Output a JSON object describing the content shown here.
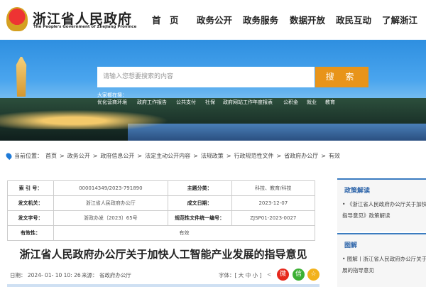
{
  "header": {
    "title": "浙江省人民政府",
    "subtitle": "The People's Government of Zhejiang Province",
    "nav": [
      "首　页",
      "政务公开",
      "政务服务",
      "数据开放",
      "政民互动",
      "了解浙江"
    ]
  },
  "search": {
    "placeholder": "请输入您想要搜索的内容",
    "button": "搜 索",
    "hot_label": "大家都在搜：",
    "hot": [
      "优化营商环境",
      "政府工作报告",
      "公共支付",
      "社保",
      "政府网站工作年度报表",
      "公积金",
      "就业",
      "教育"
    ]
  },
  "breadcrumb": {
    "label": "当前位置：",
    "items": [
      "首页",
      "政务公开",
      "政府信息公开",
      "法定主动公开内容",
      "法规政策",
      "行政规范性文件",
      "省政府办公厅",
      "有效"
    ]
  },
  "info": {
    "index_label": "索 引 号：",
    "index": "000014349/2023-791890",
    "topic_label": "主题分类：",
    "topic": "科技、教育/科技",
    "org_label": "发文机关：",
    "org": "浙江省人民政府办公厅",
    "date_label": "成文日期：",
    "date": "2023-12-07",
    "docno_label": "发文字号：",
    "docno": "浙政办发〔2023〕65号",
    "code_label": "规范性文件统一编号：",
    "code": "ZJSP01-2023-0027",
    "valid_label": "有效性：",
    "valid": "有效"
  },
  "article": {
    "title": "浙江省人民政府办公厅关于加快人工智能产业发展的指导意见",
    "date": "日期： 2024- 01- 10 10: 26",
    "source": "来源： 省政府办公厅",
    "font_label": "字体：[ 大 中 小 ]"
  },
  "side": {
    "policy_title": "政策解读",
    "policy_item": "• 《浙江省人民政府办公厅关于加快人工智能产业发展的指导意见》政策解读",
    "graphic_title": "图解",
    "graphic_item": "• 图解丨浙江省人民政府办公厅关于加快人工智能产业发展的指导意见"
  }
}
